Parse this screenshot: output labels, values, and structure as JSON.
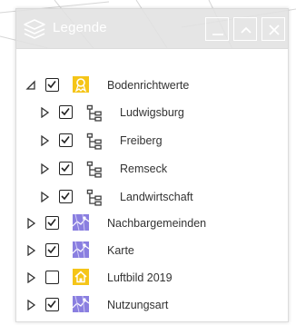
{
  "legend": {
    "title": "Legende",
    "buttons": {
      "minimize": "minimize",
      "collapse": "collapse",
      "close": "close"
    }
  },
  "tree": {
    "root": {
      "label": "Bodenrichtwerte",
      "checked": true,
      "expanded": true,
      "icon": "award-icon"
    },
    "children": [
      {
        "label": "Ludwigsburg",
        "checked": true,
        "icon": "tree-structure-icon"
      },
      {
        "label": "Freiberg",
        "checked": true,
        "icon": "tree-structure-icon"
      },
      {
        "label": "Remseck",
        "checked": true,
        "icon": "tree-structure-icon"
      },
      {
        "label": "Landwirtschaft",
        "checked": true,
        "icon": "tree-structure-icon"
      }
    ],
    "layers": [
      {
        "label": "Nachbargemeinden",
        "checked": true,
        "icon": "map-layer-icon"
      },
      {
        "label": "Karte",
        "checked": true,
        "icon": "map-layer-icon"
      },
      {
        "label": "Luftbild 2019",
        "checked": false,
        "icon": "house-icon"
      },
      {
        "label": "Nutzungsart",
        "checked": true,
        "icon": "map-layer-icon"
      }
    ]
  },
  "colors": {
    "accent_yellow": "#f5c518",
    "map_icon_purple": "#8a7fe0",
    "header_gray": "#e1e1e1"
  }
}
